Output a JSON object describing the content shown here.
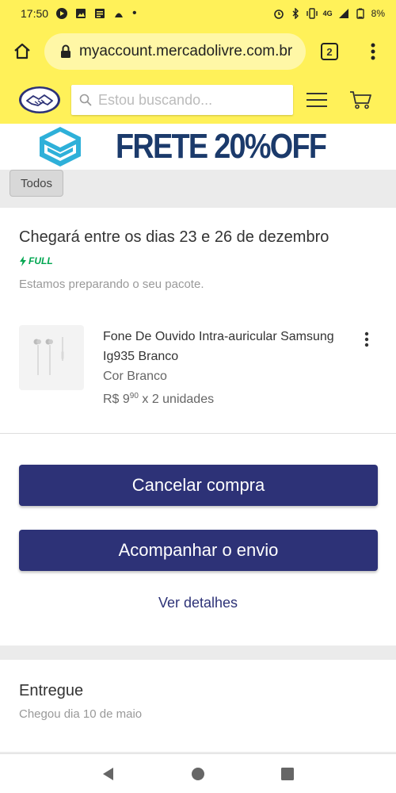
{
  "status_bar": {
    "time": "17:50",
    "network": "4G",
    "battery": "8%"
  },
  "browser": {
    "url": "myaccount.mercadolivre.com.br",
    "tab_count": "2"
  },
  "header": {
    "search_placeholder": "Estou buscando..."
  },
  "banner": {
    "text": "FRETE 20%OFF"
  },
  "filter": {
    "chip_label": "Todos"
  },
  "order": {
    "delivery_title": "Chegará entre os dias 23 e 26 de dezembro",
    "badge": "FULL",
    "status": "Estamos preparando o seu pacote.",
    "product_name": "Fone De Ouvido Intra-auricular Samsung Ig935 Branco",
    "product_color": "Cor Branco",
    "price_currency": "R$ 9",
    "price_cents": "90",
    "price_qty": " x 2 unidades",
    "cancel_label": "Cancelar compra",
    "track_label": "Acompanhar o envio",
    "details_label": "Ver detalhes"
  },
  "delivered": {
    "title": "Entregue",
    "subtitle": "Chegou dia 10 de maio"
  },
  "colors": {
    "brand_yellow": "#fff159",
    "button_blue": "#2d3277",
    "full_green": "#00a650",
    "banner_navy": "#1b3a6b"
  }
}
